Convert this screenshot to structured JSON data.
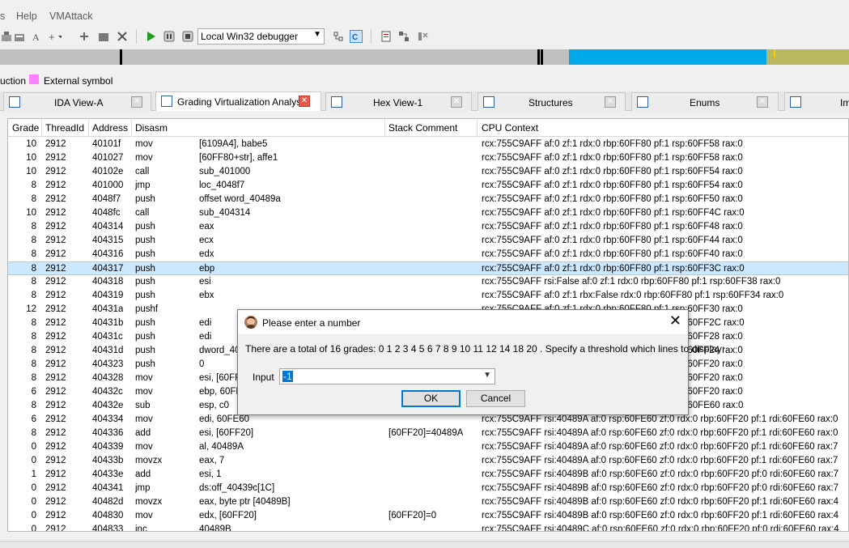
{
  "menubar": {
    "items": [
      "s",
      "Help",
      "VMAttack"
    ]
  },
  "toolbar": {
    "debugger_select": "Local Win32 debugger",
    "icons": [
      "add-icon",
      "add-struct-icon",
      "text-icon",
      "add-enum-icon",
      "expand-icon",
      "star-icon",
      "image-icon",
      "close-icon",
      "play-icon",
      "pause-icon",
      "stop-icon",
      "tree-icon",
      "decompile-icon",
      "report-icon",
      "graph-icon",
      "settings-icon"
    ]
  },
  "navband": {
    "colors": {
      "base": "#c0c0c0",
      "code": "#00a8e8",
      "data": "#b8b860",
      "marker": "#000000"
    }
  },
  "legend": {
    "prefix": "uction",
    "external_symbol": "External symbol",
    "external_color": "#ff80ff"
  },
  "tabs": [
    {
      "label": "IDA View-A",
      "icon": "ida-view-icon",
      "active": false
    },
    {
      "label": "Grading Virtualization Analysis",
      "icon": "table-icon",
      "active": true
    },
    {
      "label": "Hex View-1",
      "icon": "hex-icon",
      "active": false
    },
    {
      "label": "Structures",
      "icon": "structures-icon",
      "active": false
    },
    {
      "label": "Enums",
      "icon": "enums-icon",
      "active": false
    },
    {
      "label": "Im",
      "icon": "imports-icon",
      "active": false
    }
  ],
  "grid": {
    "columns": [
      "Grade",
      "ThreadId",
      "Address",
      "Disasm",
      "Stack Comment",
      "CPU Context"
    ],
    "rows": [
      [
        "10",
        "2912",
        "40101f",
        "mov",
        "[6109A4], babe5",
        "",
        "rcx:755C9AFF af:0 zf:1 rdx:0 rbp:60FF80 pf:1 rsp:60FF58 rax:0"
      ],
      [
        "10",
        "2912",
        "401027",
        "mov",
        "[60FF80+str], affe1",
        "",
        "rcx:755C9AFF af:0 zf:1 rdx:0 rbp:60FF80 pf:1 rsp:60FF58 rax:0"
      ],
      [
        "10",
        "2912",
        "40102e",
        "call",
        "sub_401000",
        "",
        "rcx:755C9AFF af:0 zf:1 rdx:0 rbp:60FF80 pf:1 rsp:60FF54 rax:0"
      ],
      [
        "8",
        "2912",
        "401000",
        "jmp",
        "loc_4048f7",
        "",
        "rcx:755C9AFF af:0 zf:1 rdx:0 rbp:60FF80 pf:1 rsp:60FF54 rax:0"
      ],
      [
        "8",
        "2912",
        "4048f7",
        "push",
        "offset word_40489a",
        "",
        "rcx:755C9AFF af:0 zf:1 rdx:0 rbp:60FF80 pf:1 rsp:60FF50 rax:0"
      ],
      [
        "10",
        "2912",
        "4048fc",
        "call",
        "sub_404314",
        "",
        "rcx:755C9AFF af:0 zf:1 rdx:0 rbp:60FF80 pf:1 rsp:60FF4C rax:0"
      ],
      [
        "8",
        "2912",
        "404314",
        "push",
        "eax",
        "",
        "rcx:755C9AFF af:0 zf:1 rdx:0 rbp:60FF80 pf:1 rsp:60FF48 rax:0"
      ],
      [
        "8",
        "2912",
        "404315",
        "push",
        "ecx",
        "",
        "rcx:755C9AFF af:0 zf:1 rdx:0 rbp:60FF80 pf:1 rsp:60FF44 rax:0"
      ],
      [
        "8",
        "2912",
        "404316",
        "push",
        "edx",
        "",
        "rcx:755C9AFF af:0 zf:1 rdx:0 rbp:60FF80 pf:1 rsp:60FF40 rax:0"
      ],
      [
        "8",
        "2912",
        "404317",
        "push",
        "ebp",
        "",
        "rcx:755C9AFF af:0 zf:1 rdx:0 rbp:60FF80 pf:1 rsp:60FF3C rax:0"
      ],
      [
        "8",
        "2912",
        "404318",
        "push",
        "esi",
        "",
        "rcx:755C9AFF rsi:False af:0 zf:1 rdx:0 rbp:60FF80 pf:1 rsp:60FF38 rax:0"
      ],
      [
        "8",
        "2912",
        "404319",
        "push",
        "ebx",
        "",
        "rcx:755C9AFF af:0 zf:1 rbx:False rdx:0 rbp:60FF80 pf:1 rsp:60FF34 rax:0"
      ],
      [
        "12",
        "2912",
        "40431a",
        "pushf",
        "",
        "",
        "rcx:755C9AFF af:0 zf:1 rdx:0 rbp:60FF80 pf:1 rsp:60FF30 rax:0"
      ],
      [
        "8",
        "2912",
        "40431b",
        "push",
        "edi",
        "",
        "rcx:755C9AFF af:0 zf:1 rdx:0 rbp:60FF80 pf:1 rsp:60FF2C rax:0"
      ],
      [
        "8",
        "2912",
        "40431c",
        "push",
        "edi",
        "",
        "rcx:755C9AFF af:0 zf:1 rdx:0 rbp:60FF80 pf:1 rsp:60FF28 rax:0"
      ],
      [
        "8",
        "2912",
        "40431d",
        "push",
        "dword_40",
        "",
        "rcx:755C9AFF af:0 zf:1 rdx:0 rbp:60FF80 pf:1 rsp:60FF24 rax:0"
      ],
      [
        "8",
        "2912",
        "404323",
        "push",
        "0",
        "",
        "rcx:755C9AFF af:0 zf:1 rdx:0 rbp:60FF80 pf:1 rsp:60FF20 rax:0"
      ],
      [
        "8",
        "2912",
        "404328",
        "mov",
        "esi, [60FF",
        "",
        "rcx:755C9AFF af:0 zf:1 rdx:0 rbp:60FF80 pf:1 rsp:60FF20 rax:0"
      ],
      [
        "6",
        "2912",
        "40432c",
        "mov",
        "ebp, 60FF",
        "",
        "rcx:755C9AFF af:0 zf:1 rdx:0 rbp:60FF80 pf:1 rsp:60FF20 rax:0"
      ],
      [
        "8",
        "2912",
        "40432e",
        "sub",
        "esp, c0",
        "",
        "rcx:755C9AFF af:0 zf:1 rdx:0 rbp:60FF80 pf:1 rsp:60FE60 rax:0"
      ],
      [
        "6",
        "2912",
        "404334",
        "mov",
        "edi, 60FE60",
        "",
        "rcx:755C9AFF rsi:40489A af:0 rsp:60FE60 zf:0 rdx:0 rbp:60FF20 pf:1 rdi:60FE60 rax:0"
      ],
      [
        "8",
        "2912",
        "404336",
        "add",
        "esi, [60FF20]",
        "[60FF20]=40489A",
        "rcx:755C9AFF rsi:40489A af:0 rsp:60FE60 zf:0 rdx:0 rbp:60FF20 pf:1 rdi:60FE60 rax:0"
      ],
      [
        "0",
        "2912",
        "404339",
        "mov",
        "al, 40489A",
        "",
        "rcx:755C9AFF rsi:40489A af:0 rsp:60FE60 zf:0 rdx:0 rbp:60FF20 pf:1 rdi:60FE60 rax:7"
      ],
      [
        "0",
        "2912",
        "40433b",
        "movzx",
        "eax, 7",
        "",
        "rcx:755C9AFF rsi:40489A af:0 rsp:60FE60 zf:0 rdx:0 rbp:60FF20 pf:1 rdi:60FE60 rax:7"
      ],
      [
        "1",
        "2912",
        "40433e",
        "add",
        "esi, 1",
        "",
        "rcx:755C9AFF rsi:40489B af:0 rsp:60FE60 zf:0 rdx:0 rbp:60FF20 pf:0 rdi:60FE60 rax:7"
      ],
      [
        "0",
        "2912",
        "404341",
        "jmp",
        "ds:off_40439c[1C]",
        "",
        "rcx:755C9AFF rsi:40489B af:0 rsp:60FE60 zf:0 rdx:0 rbp:60FF20 pf:0 rdi:60FE60 rax:7"
      ],
      [
        "0",
        "2912",
        "40482d",
        "movzx",
        "eax, byte ptr [40489B]",
        "",
        "rcx:755C9AFF rsi:40489B af:0 rsp:60FE60 zf:0 rdx:0 rbp:60FF20 pf:1 rdi:60FE60 rax:4"
      ],
      [
        "0",
        "2912",
        "404830",
        "mov",
        "edx, [60FF20]",
        "[60FF20]=0",
        "rcx:755C9AFF rsi:40489B af:0 rsp:60FE60 zf:0 rdx:0 rbp:60FF20 pf:1 rdi:60FE60 rax:4"
      ],
      [
        "0",
        "2912",
        "404833",
        "inc",
        "40489B",
        "",
        "rcx:755C9AFF rsi:40489C af:0 rsp:60FE60 zf:0 rdx:0 rbp:60FF20 pf:0 rdi:60FE60 rax:4"
      ]
    ],
    "selected_index": 9
  },
  "dialog": {
    "title": "Please enter a number",
    "message": "There are a total of 16 grades: 0 1 2 3 4 5 6 7 8 9 10 11 12 14 18 20 . Specify a threshold which lines to display:",
    "input_label": "Input",
    "input_value": "-1",
    "ok_label": "OK",
    "cancel_label": "Cancel"
  }
}
